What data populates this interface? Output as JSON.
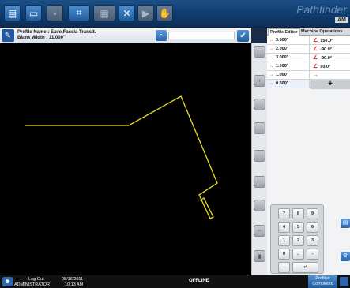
{
  "app": {
    "brand": "Pathfinder",
    "brand_sub": "AM"
  },
  "toolbar": {
    "buttons": [
      {
        "icon": "document-icon"
      },
      {
        "icon": "folder-icon"
      },
      {
        "icon": "save-icon"
      },
      {
        "icon": "layers-icon"
      },
      {
        "icon": "grid-icon"
      },
      {
        "icon": "tools-icon"
      },
      {
        "icon": "play-icon"
      },
      {
        "icon": "hand-icon"
      }
    ]
  },
  "profile": {
    "name_label": "Profile Name :",
    "name_value": "Eave,Fascia Transit.",
    "blank_label": "Blank Width :",
    "blank_value": "11.000\""
  },
  "tabs": [
    {
      "label": "Profile Editor",
      "active": true
    },
    {
      "label": "Machine Operations",
      "active": false
    }
  ],
  "segments": [
    {
      "length": "3.500\"",
      "angle": "150.0°"
    },
    {
      "length": "2.000\"",
      "angle": "-90.0°"
    },
    {
      "length": "3.000\"",
      "angle": "-90.0°"
    },
    {
      "length": "1.000\"",
      "angle": "90.0°"
    },
    {
      "length": "1.000\"",
      "angle": ""
    },
    {
      "length": "0.500\"",
      "angle": ""
    }
  ],
  "add_label": "+",
  "keypad": {
    "keys": [
      "7",
      "8",
      "9",
      "4",
      "5",
      "6",
      "1",
      "2",
      "3",
      "0",
      "←",
      "-",
      "-",
      "↵"
    ]
  },
  "status": {
    "logout": "Log Out",
    "user": "ADMINISTRATOR",
    "date": "08/16/2011",
    "time": "10:13 AM",
    "connection": "OFFLINE",
    "completed_line1": "Profiles",
    "completed_line2": "Completed"
  },
  "colors": {
    "profile_line": "#e8e020",
    "accent": "#2457a3"
  }
}
